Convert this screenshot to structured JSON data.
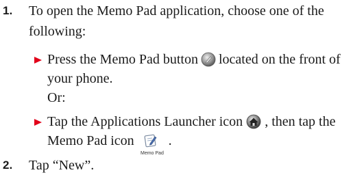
{
  "steps": [
    {
      "number": "1.",
      "line1": "To open the Memo Pad application, choose one of the",
      "line2": "following:",
      "bullets": [
        {
          "line1_before": "Press the Memo Pad button",
          "line1_after": "located on the front of",
          "line2": "your phone.",
          "icon": "memo-pad-button-icon"
        },
        {
          "line1_before": "Tap the Applications Launcher icon",
          "line1_after": ", then tap the",
          "line2_before": "Memo Pad icon",
          "line2_after": ".",
          "icon": "applications-launcher-icon",
          "icon2": "memo-pad-icon",
          "icon2_caption": "Memo Pad"
        }
      ],
      "or_text": "Or:"
    },
    {
      "number": "2.",
      "text": "Tap “New”."
    }
  ],
  "colors": {
    "bullet_arrow": "#e2001a",
    "text": "#1a1a1a"
  }
}
